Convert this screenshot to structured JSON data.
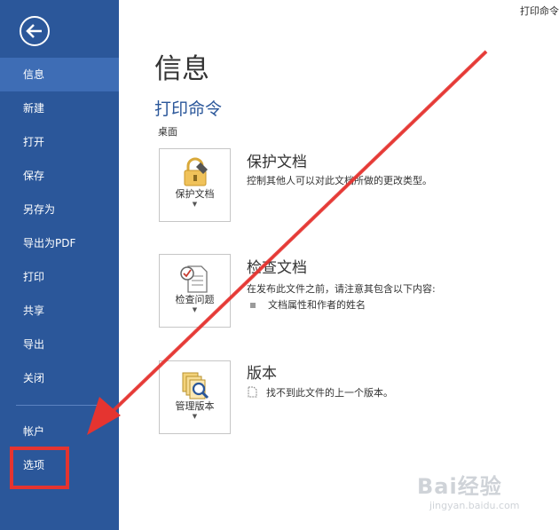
{
  "top_right": "打印命令",
  "sidebar": {
    "items": [
      {
        "label": "信息"
      },
      {
        "label": "新建"
      },
      {
        "label": "打开"
      },
      {
        "label": "保存"
      },
      {
        "label": "另存为"
      },
      {
        "label": "导出为PDF"
      },
      {
        "label": "打印"
      },
      {
        "label": "共享"
      },
      {
        "label": "导出"
      },
      {
        "label": "关闭"
      }
    ],
    "account": "帐户",
    "options": "选项"
  },
  "main": {
    "title": "信息",
    "doc_name": "打印命令",
    "doc_location": "桌面",
    "sections": [
      {
        "button_label": "保护文档",
        "title": "保护文档",
        "desc": "控制其他人可以对此文档所做的更改类型。",
        "bullets": []
      },
      {
        "button_label": "检查问题",
        "title": "检查文档",
        "desc": "在发布此文件之前，请注意其包含以下内容:",
        "bullets": [
          "文档属性和作者的姓名"
        ]
      },
      {
        "button_label": "管理版本",
        "title": "版本",
        "desc": "找不到此文件的上一个版本。",
        "bullets": []
      }
    ]
  },
  "watermark": {
    "logo": "Bai经验",
    "url": "jingyan.baidu.com"
  },
  "colors": {
    "sidebar": "#2b579a",
    "sidebar_active": "#3e6db5",
    "accent_title": "#2b579a",
    "annotation_red": "#e53430"
  },
  "icons": {
    "back": "back-arrow-icon",
    "protect": "lock-icon",
    "inspect": "inspect-document-icon",
    "versions": "manage-versions-icon",
    "version_doc": "document-icon"
  }
}
